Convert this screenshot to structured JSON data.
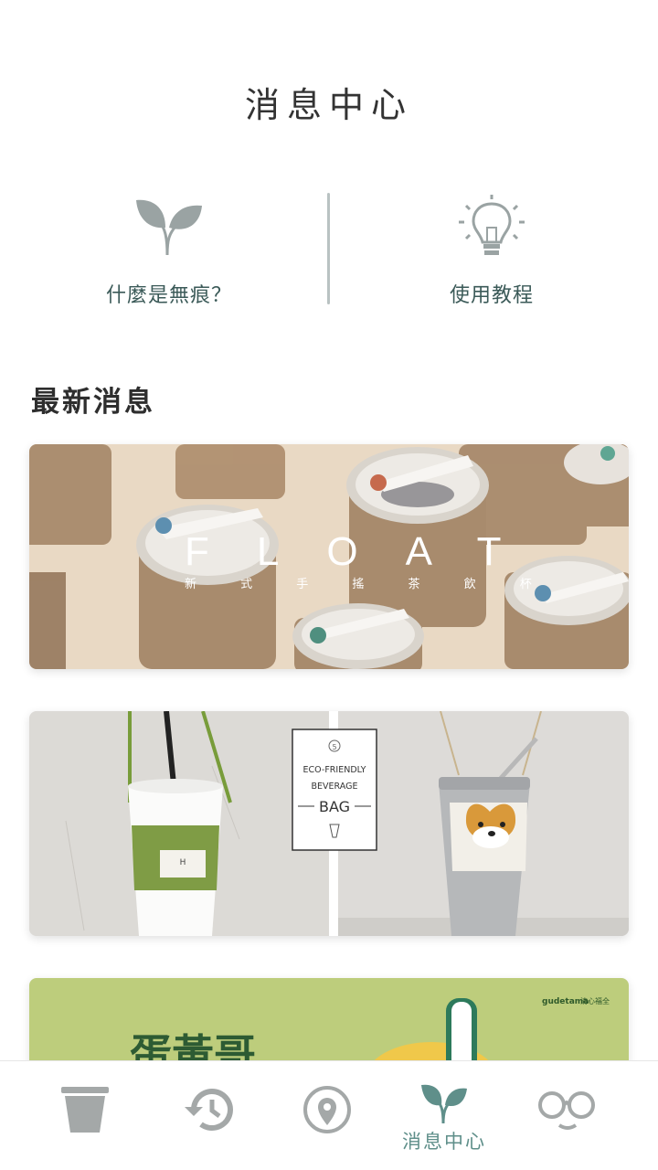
{
  "page": {
    "title": "消息中心"
  },
  "quick_links": [
    {
      "label": "什麼是無痕？",
      "icon": "leaf-icon"
    },
    {
      "label": "使用教程",
      "icon": "lightbulb-icon"
    }
  ],
  "news": {
    "title": "最新消息",
    "cards": [
      {
        "heading": "FLOAT",
        "subheading": "新 式 手 搖 茶 飲 杯"
      },
      {
        "badge": "5",
        "line1": "ECO-FRIENDLY",
        "line2": "BEVERAGE",
        "line3": "BAG",
        "tag_label": "H"
      },
      {
        "brand": "gudetama",
        "brand_sub": "清心福全",
        "headline": "蛋黃哥"
      }
    ]
  },
  "bottom_nav": {
    "items": [
      {
        "icon": "cup-icon",
        "label": ""
      },
      {
        "icon": "history-icon",
        "label": ""
      },
      {
        "icon": "location-pin-icon",
        "label": ""
      },
      {
        "icon": "sprout-icon",
        "label": "消息中心",
        "active": true
      },
      {
        "icon": "glasses-icon",
        "label": ""
      }
    ]
  },
  "colors": {
    "accent": "#5f8f8a",
    "icon_gray": "#9aa3a3",
    "card3_bg": "#bdcd7c"
  }
}
